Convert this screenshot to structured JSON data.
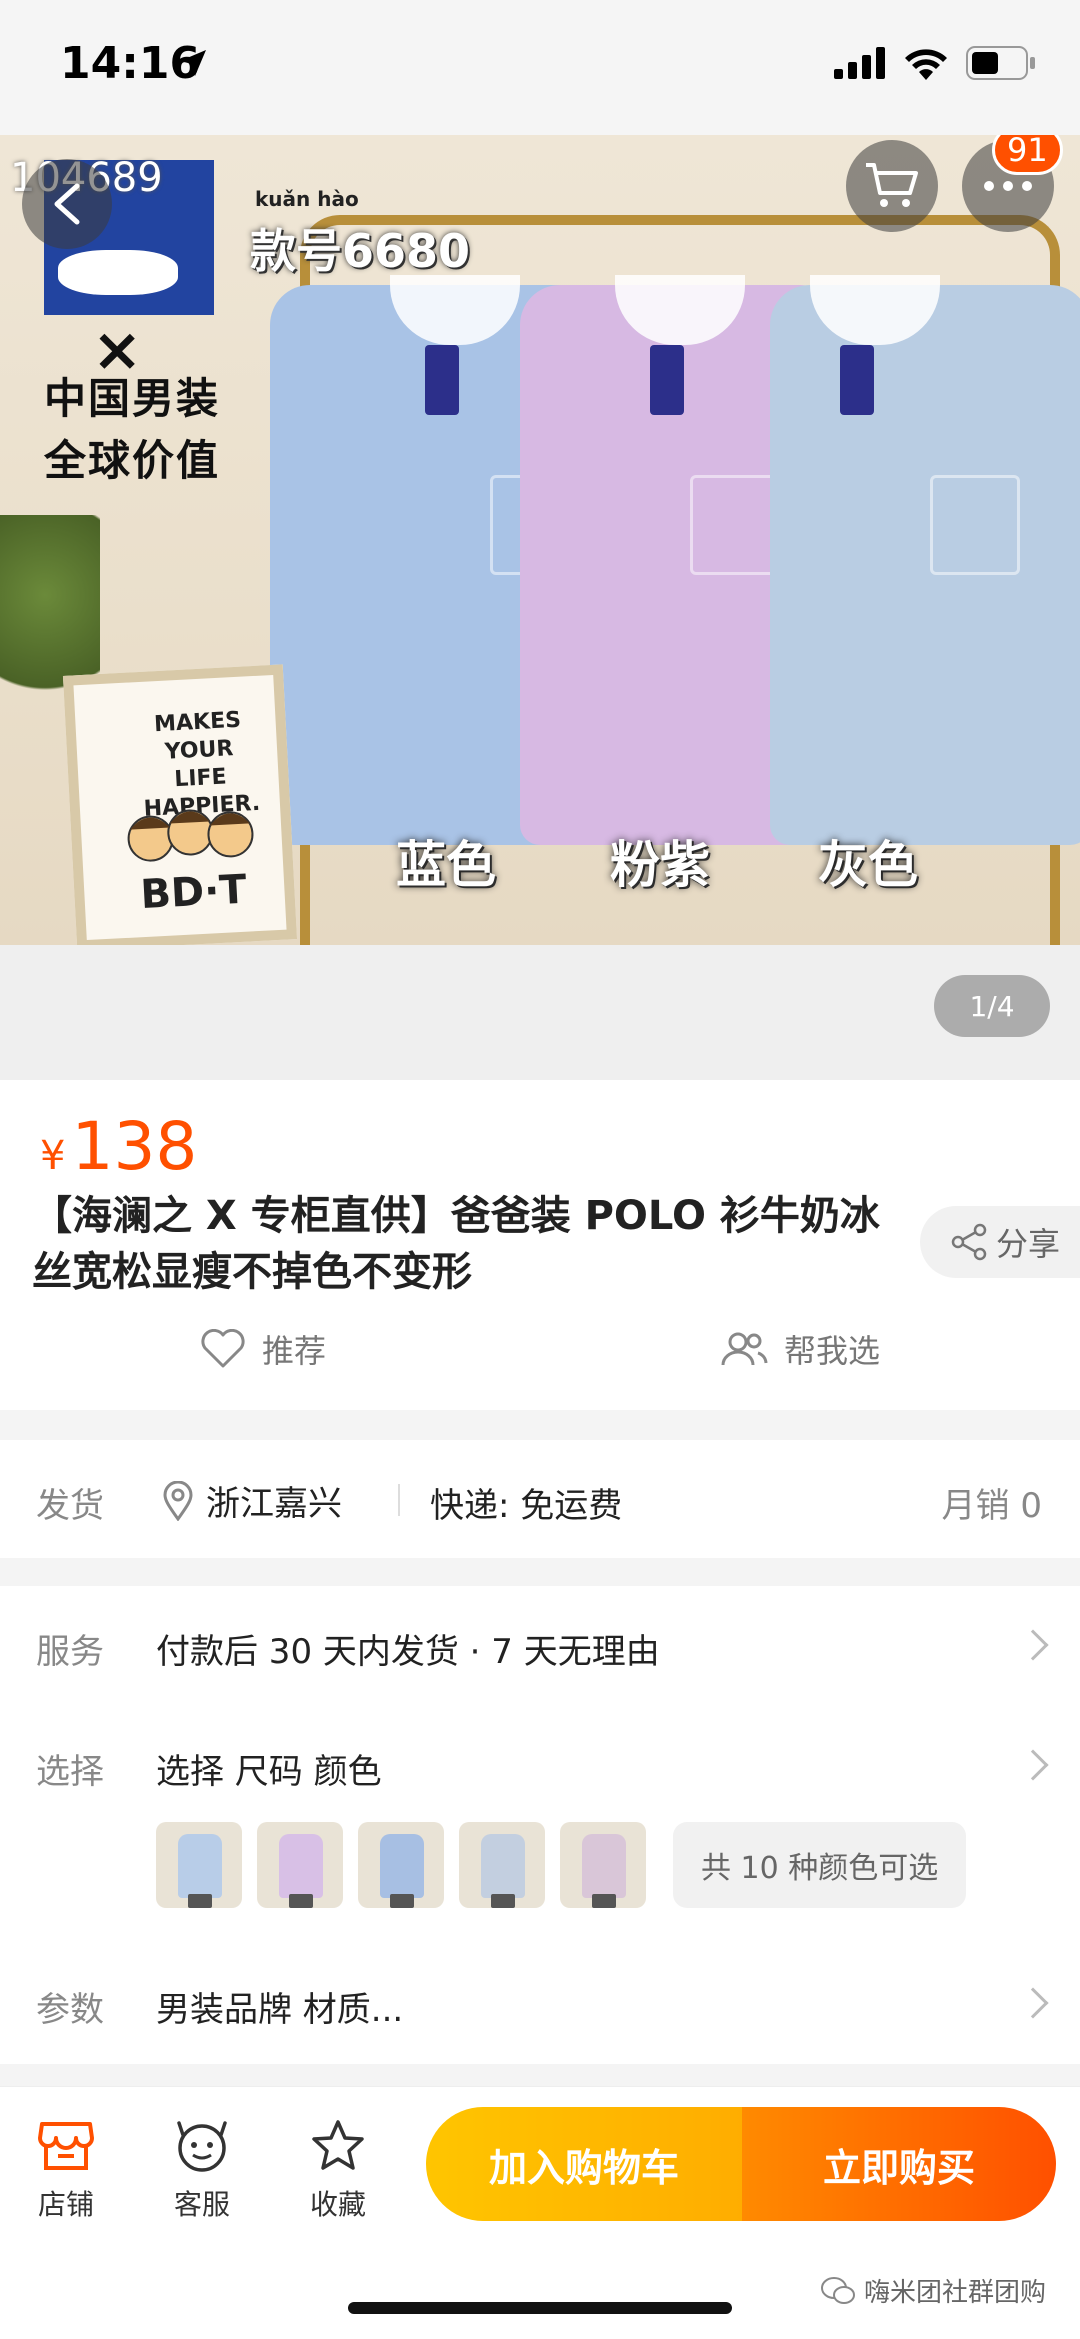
{
  "status_bar": {
    "time": "14:16"
  },
  "hero": {
    "overlay_id": "104689",
    "cart_badge": "91",
    "page_counter": "1/4",
    "model_pinyin": "kuǎn hào",
    "model_number": "款号6680",
    "brand_x": "×",
    "brand_line1": "中国男装",
    "brand_line2": "全球价值",
    "sign_text": "MAKES YOUR LIFE HAPPIER.",
    "sign_logo": "BD·T",
    "color_labels": [
      "蓝色",
      "粉紫",
      "灰色"
    ],
    "colors": {
      "blue": "#a9c3e6",
      "purple": "#d7b9e3",
      "grey": "#b9cde3",
      "rack": "#b88f3a"
    }
  },
  "product": {
    "currency": "¥",
    "price": "138",
    "title": "【海澜之 X 专柜直供】爸爸装 POLO 衫牛奶冰丝宽松显瘦不掉色不变形",
    "share_label": "分享",
    "recommend_label": "推荐",
    "help_choose_label": "帮我选",
    "accent": "#ff5000"
  },
  "shipping": {
    "label": "发货",
    "location": "浙江嘉兴",
    "express": "快递: 免运费",
    "monthly_sales": "月销 0"
  },
  "options": {
    "service_label": "服务",
    "service_text": "付款后 30 天内发货 · 7 天无理由",
    "select_label": "选择",
    "select_text": "选择  尺码 颜色",
    "color_count": "共 10 种颜色可选",
    "param_label": "参数",
    "param_text": "男装品牌 材质..."
  },
  "bottom_bar": {
    "shop_label": "店铺",
    "service_label": "客服",
    "favorite_label": "收藏",
    "add_cart_label": "加入购物车",
    "buy_now_label": "立即购买"
  },
  "watermark": "嗨米团社群团购"
}
